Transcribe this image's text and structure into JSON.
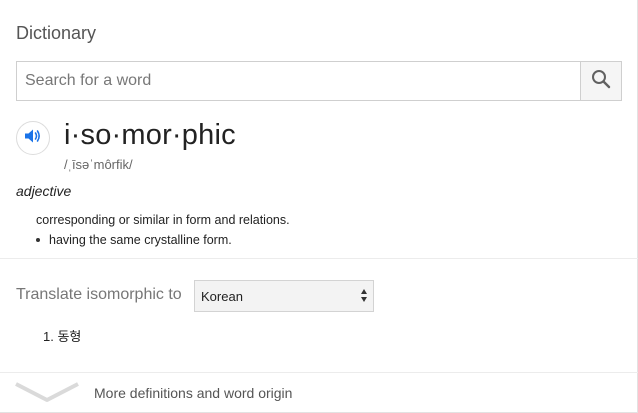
{
  "header": {
    "title": "Dictionary"
  },
  "search": {
    "placeholder": "Search for a word",
    "value": ""
  },
  "entry": {
    "headword": "i·so·mor·phic",
    "phonetic": "/ˌīsəˈmôrfik/",
    "part_of_speech": "adjective",
    "definition": "corresponding or similar in form and relations.",
    "sub_definitions": [
      "having the same crystalline form."
    ]
  },
  "translate": {
    "label": "Translate isomorphic to",
    "selected_language": "Korean",
    "results": [
      {
        "number": "1.",
        "text": "동형"
      }
    ]
  },
  "footer": {
    "more_label": "More definitions and word origin"
  },
  "colors": {
    "accent": "#1a73e8",
    "icon_gray": "#616161"
  },
  "icons": {
    "search": "search-icon",
    "speaker": "speaker-icon",
    "expand": "chevron-down-icon"
  }
}
